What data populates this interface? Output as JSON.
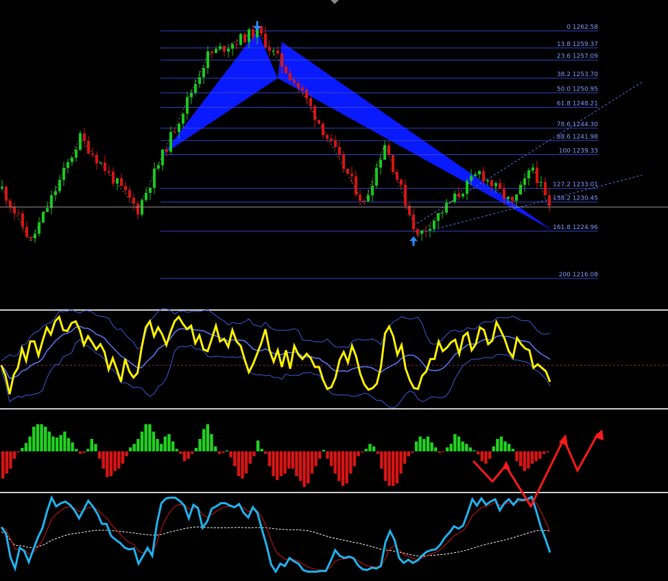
{
  "colors": {
    "background": "#000000",
    "fib_line": "#3046c8",
    "fib_label": "#7f9bff",
    "pattern_fill": "#0a1aff",
    "bull_candle": "#19c81e",
    "bear_candle": "#d81414",
    "osc_main": "#fff200",
    "osc_band": "#3a5bdc",
    "hist_up": "#1fd21f",
    "hist_down": "#d81414",
    "stoch_main": "#1eb4f0",
    "stoch_signal": "#d81414",
    "stoch_slow": "#ffffff",
    "arrow_marker": "#2b8cff",
    "annotation": "#ff1a1a",
    "panel_separator": "#cfcfcf"
  },
  "chart_data": [
    {
      "type": "candlestick",
      "panel": "price",
      "fib_levels": [
        {
          "ratio": "0",
          "price": "1262.58"
        },
        {
          "ratio": "13.8",
          "price": "1259.37"
        },
        {
          "ratio": "23.6",
          "price": "1257.09"
        },
        {
          "ratio": "38.2",
          "price": "1253.70"
        },
        {
          "ratio": "50.0",
          "price": "1250.95"
        },
        {
          "ratio": "61.8",
          "price": "1248.21"
        },
        {
          "ratio": "78.6",
          "price": "1244.30"
        },
        {
          "ratio": "88.6",
          "price": "1241.98"
        },
        {
          "ratio": "100",
          "price": "1239.33"
        },
        {
          "ratio": "127.2",
          "price": "1233.01"
        },
        {
          "ratio": "138.2",
          "price": "1230.45"
        },
        {
          "ratio": "161.8",
          "price": "1224.96"
        },
        {
          "ratio": "200",
          "price": "1216.08"
        }
      ],
      "ylim": [
        1212,
        1265
      ],
      "harmonic_pattern": {
        "X": [
          39,
          1239.3
        ],
        "A": [
          62,
          1262.6
        ],
        "B": [
          67,
          1253.7
        ],
        "C": [
          68,
          1260.5
        ],
        "D": [
          134,
          1225.0
        ]
      },
      "arrows": [
        {
          "type": "down",
          "bar": 62,
          "price": 1262.6
        },
        {
          "type": "up",
          "bar": 100,
          "price": 1224.0
        }
      ],
      "trendlines": [
        {
          "from": [
            101,
            1224.5
          ],
          "to": [
            158,
            1236.0
          ]
        },
        {
          "from": [
            100,
            1226.0
          ],
          "to": [
            135,
            1243.0
          ]
        }
      ],
      "swings": [
        [
          0,
          1233
        ],
        [
          7,
          1223
        ],
        [
          19,
          1242.5
        ],
        [
          33,
          1229
        ],
        [
          50,
          1258
        ],
        [
          62,
          1262.6
        ],
        [
          73,
          1251
        ],
        [
          88,
          1230
        ],
        [
          93,
          1241.5
        ],
        [
          101,
          1224
        ],
        [
          116,
          1236
        ],
        [
          124,
          1230
        ],
        [
          129,
          1237
        ],
        [
          133,
          1229.2
        ]
      ],
      "last_price_line": 1229.5,
      "bars": 134
    },
    {
      "type": "line",
      "panel": "oscillator_with_bands",
      "series": [
        {
          "key": "main",
          "values": [
            0.45,
            0.33,
            0.12,
            0.34,
            0.42,
            0.64,
            0.5,
            0.72,
            0.72,
            0.56,
            0.73,
            0.88,
            0.8,
            0.95,
            1.0,
            0.85,
            0.84,
            0.93,
            0.95,
            0.85,
            0.68,
            0.78,
            0.71,
            0.63,
            0.69,
            0.6,
            0.4,
            0.53,
            0.4,
            0.26,
            0.52,
            0.38,
            0.31,
            0.36,
            0.65,
            0.88,
            0.95,
            0.78,
            0.88,
            0.8,
            0.68,
            0.83,
            0.95,
            1.0,
            0.92,
            0.86,
            0.9,
            0.7,
            0.79,
            0.63,
            0.61,
            0.75,
            0.9,
            0.72,
            0.75,
            0.66,
            0.85,
            0.72,
            0.67,
            0.51,
            0.37,
            0.46,
            0.58,
            0.7,
            0.86,
            0.62,
            0.49,
            0.62,
            0.43,
            0.62,
            0.41,
            0.67,
            0.57,
            0.52,
            0.58,
            0.53,
            0.43,
            0.43,
            0.28,
            0.18,
            0.2,
            0.31,
            0.51,
            0.6,
            0.48,
            0.67,
            0.55,
            0.35,
            0.23,
            0.17,
            0.19,
            0.24,
            0.43,
            0.81,
            0.89,
            0.78,
            0.57,
            0.68,
            0.41,
            0.28,
            0.19,
            0.18,
            0.33,
            0.38,
            0.52,
            0.52,
            0.72,
            0.61,
            0.65,
            0.71,
            0.74,
            0.58,
            0.78,
            0.82,
            0.62,
            0.69,
            0.88,
            0.85,
            0.69,
            0.73,
            0.94,
            0.85,
            0.75,
            0.61,
            0.54,
            0.76,
            0.69,
            0.64,
            0.62,
            0.42,
            0.46,
            0.42,
            0.38,
            0.26
          ]
        }
      ],
      "ylim": [
        0,
        1
      ],
      "zero_line": 0.45
    },
    {
      "type": "bar",
      "panel": "histogram",
      "values": [
        -0.55,
        -0.45,
        -0.35,
        -0.15,
        -0.02,
        0.07,
        0.17,
        0.3,
        0.5,
        0.55,
        0.55,
        0.5,
        0.4,
        0.3,
        0.28,
        0.33,
        0.4,
        0.27,
        0.18,
        0.05,
        -0.05,
        -0.03,
        0.05,
        0.25,
        0.15,
        -0.15,
        -0.35,
        -0.52,
        -0.5,
        -0.4,
        -0.35,
        -0.25,
        -0.1,
        0.08,
        0.15,
        0.25,
        0.4,
        0.55,
        0.55,
        0.4,
        0.25,
        0.15,
        0.3,
        0.35,
        0.2,
        0.05,
        -0.05,
        -0.2,
        -0.15,
        -0.05,
        0.07,
        0.25,
        0.45,
        0.55,
        0.35,
        0.1,
        -0.05,
        -0.03,
        0.02,
        -0.12,
        -0.3,
        -0.5,
        -0.55,
        -0.45,
        -0.25,
        -0.1,
        0.22,
        0.05,
        -0.05,
        -0.3,
        -0.5,
        -0.58,
        -0.5,
        -0.45,
        -0.35,
        -0.35,
        -0.5,
        -0.6,
        -0.72,
        -0.65,
        -0.45,
        -0.3,
        -0.15,
        0.03,
        -0.15,
        -0.3,
        -0.45,
        -0.6,
        -0.7,
        -0.65,
        -0.45,
        -0.3,
        -0.1,
        -0.02,
        0.05,
        0.15,
        0.1,
        -0.05,
        -0.35,
        -0.6,
        -0.7,
        -0.7,
        -0.65,
        -0.45,
        -0.25,
        -0.1,
        -0.03,
        0.2,
        0.3,
        0.25,
        0.3,
        0.18,
        0.08,
        -0.03,
        -0.01,
        0.08,
        0.15,
        0.35,
        0.3,
        0.2,
        0.15,
        0.08,
        0.02,
        -0.06,
        -0.2,
        -0.25,
        -0.15,
        0.1,
        0.25,
        0.3,
        0.2,
        0.15,
        0.05,
        -0.2,
        -0.3,
        -0.4,
        -0.35,
        -0.25,
        -0.2,
        -0.15,
        -0.05,
        -0.02
      ],
      "ylim": [
        -0.75,
        0.75
      ]
    },
    {
      "type": "line",
      "panel": "stochastic",
      "series": [
        {
          "key": "main",
          "values": [
            0.6,
            0.52,
            0.22,
            0.08,
            0.34,
            0.3,
            0.16,
            0.32,
            0.47,
            0.59,
            0.8,
            0.97,
            0.86,
            0.9,
            0.92,
            0.88,
            0.81,
            0.71,
            0.82,
            0.93,
            0.86,
            0.77,
            0.64,
            0.64,
            0.49,
            0.44,
            0.4,
            0.34,
            0.32,
            0.33,
            0.14,
            0.24,
            0.34,
            0.24,
            0.64,
            0.9,
            0.96,
            0.97,
            0.97,
            0.93,
            0.87,
            0.71,
            0.88,
            0.84,
            0.59,
            0.67,
            0.83,
            0.86,
            0.9,
            0.9,
            0.87,
            0.85,
            0.89,
            0.78,
            0.72,
            0.85,
            0.78,
            0.57,
            0.37,
            0.13,
            0.04,
            0.14,
            0.11,
            0.21,
            0.17,
            0.14,
            0.06,
            0.04,
            0.04,
            0.04,
            0.05,
            0.05,
            0.17,
            0.31,
            0.24,
            0.21,
            0.23,
            0.21,
            0.12,
            0.07,
            0.06,
            0.09,
            0.08,
            0.11,
            0.41,
            0.55,
            0.44,
            0.21,
            0.15,
            0.19,
            0.15,
            0.18,
            0.24,
            0.29,
            0.31,
            0.32,
            0.38,
            0.47,
            0.53,
            0.61,
            0.58,
            0.62,
            0.78,
            0.95,
            0.87,
            0.96,
            0.88,
            0.92,
            0.95,
            0.81,
            0.9,
            0.95,
            0.88,
            0.95,
            0.94,
            0.95,
            0.98,
            0.8,
            0.6,
            0.45,
            0.28
          ]
        }
      ],
      "ylim": [
        0,
        1
      ]
    }
  ]
}
